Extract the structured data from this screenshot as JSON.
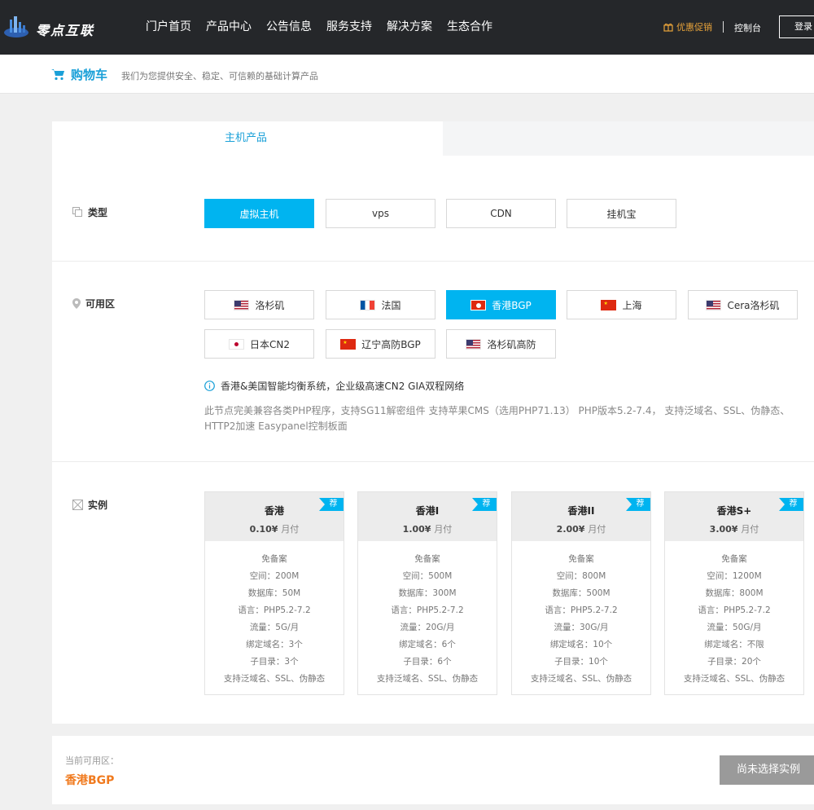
{
  "brand": {
    "name": "零点互联"
  },
  "nav": {
    "items": [
      "门户首页",
      "产品中心",
      "公告信息",
      "服务支持",
      "解决方案",
      "生态合作"
    ]
  },
  "header": {
    "promo": "优惠促销",
    "console": "控制台",
    "login": "登录"
  },
  "subheader": {
    "title": "购物车",
    "subtitle": "我们为您提供安全、稳定、可信赖的基础计算产品"
  },
  "tabs": {
    "active": "主机产品"
  },
  "type_section": {
    "label": "类型",
    "options": [
      "虚拟主机",
      "vps",
      "CDN",
      "挂机宝"
    ],
    "selected": "虚拟主机"
  },
  "zone_section": {
    "label": "可用区",
    "options": [
      {
        "name": "洛杉矶",
        "flag": "us"
      },
      {
        "name": "法国",
        "flag": "fr"
      },
      {
        "name": "香港BGP",
        "flag": "hk"
      },
      {
        "name": "上海",
        "flag": "cn"
      },
      {
        "name": "Cera洛杉矶",
        "flag": "us"
      },
      {
        "name": "日本CN2",
        "flag": "jp"
      },
      {
        "name": "辽宁高防BGP",
        "flag": "cn"
      },
      {
        "name": "洛杉矶高防",
        "flag": "us"
      }
    ],
    "selected": "香港BGP",
    "info": "香港&美国智能均衡系统，企业级高速CN2 GIA双程网络",
    "desc": "此节点完美兼容各类PHP程序，支持SG11解密组件 支持苹果CMS（选用PHP71.13） PHP版本5.2-7.4， 支持泛域名、SSL、伪静态、HTTP2加速 Easypanel控制板面"
  },
  "instance_section": {
    "label": "实例",
    "tag": "荐",
    "plans": [
      {
        "name": "香港",
        "price": "0.10¥",
        "period": "月付",
        "features": [
          "免备案",
          "空间：200M",
          "数据库：50M",
          "语言：PHP5.2-7.2",
          "流量：5G/月",
          "绑定域名：3个",
          "子目录：3个",
          "支持泛域名、SSL、伪静态"
        ]
      },
      {
        "name": "香港I",
        "price": "1.00¥",
        "period": "月付",
        "features": [
          "免备案",
          "空间：500M",
          "数据库：300M",
          "语言：PHP5.2-7.2",
          "流量：20G/月",
          "绑定域名：6个",
          "子目录：6个",
          "支持泛域名、SSL、伪静态"
        ]
      },
      {
        "name": "香港II",
        "price": "2.00¥",
        "period": "月付",
        "features": [
          "免备案",
          "空间：800M",
          "数据库：500M",
          "语言：PHP5.2-7.2",
          "流量：30G/月",
          "绑定域名：10个",
          "子目录：10个",
          "支持泛域名、SSL、伪静态"
        ]
      },
      {
        "name": "香港S+",
        "price": "3.00¥",
        "period": "月付",
        "features": [
          "免备案",
          "空间：1200M",
          "数据库：800M",
          "语言：PHP5.2-7.2",
          "流量：50G/月",
          "绑定域名：不限",
          "子目录：20个",
          "支持泛域名、SSL、伪静态"
        ]
      }
    ]
  },
  "footer": {
    "current_label": "当前可用区：",
    "current_zone": "香港BGP",
    "action": "尚未选择实例"
  },
  "colors": {
    "accent": "#00b4f0",
    "topbar": "#25272a",
    "zone_text": "#f07a1e",
    "promo": "#e8a33a"
  }
}
